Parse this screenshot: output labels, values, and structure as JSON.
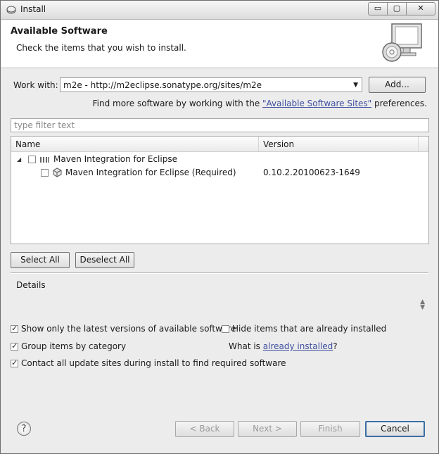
{
  "window": {
    "title": "Install",
    "controls": {
      "minimize": "▭",
      "maximize": "▢",
      "close": "✕"
    }
  },
  "banner": {
    "title": "Available Software",
    "description": "Check the items that you wish to install."
  },
  "work_with": {
    "label": "Work with:",
    "value": "m2e - http://m2eclipse.sonatype.org/sites/m2e",
    "add_button": "Add..."
  },
  "find_more": {
    "prefix": "Find more software by working with the ",
    "link": "\"Available Software Sites\"",
    "suffix": " preferences."
  },
  "filter": {
    "placeholder": "type filter text",
    "value": ""
  },
  "tree": {
    "columns": {
      "name": "Name",
      "version": "Version"
    },
    "rows": [
      {
        "expander": "◢",
        "checked": false,
        "icon": "category-icon",
        "name": "Maven Integration for Eclipse",
        "version": ""
      },
      {
        "checked": false,
        "icon": "feature-plugin-icon",
        "name": "Maven Integration for Eclipse (Required)",
        "version": "0.10.2.20100623-1649"
      }
    ]
  },
  "buttons": {
    "select_all": "Select All",
    "deselect_all": "Deselect All",
    "back": "< Back",
    "next": "Next >",
    "finish": "Finish",
    "cancel": "Cancel"
  },
  "details": {
    "label": "Details"
  },
  "options": {
    "show_latest": {
      "label": "Show only the latest versions of available software",
      "checked": true
    },
    "hide_installed": {
      "label": "Hide items that are already installed",
      "checked": false
    },
    "group_by_category": {
      "label": "Group items by category",
      "checked": true
    },
    "what_is_prefix": "What is ",
    "what_is_link": "already installed",
    "what_is_suffix": "?",
    "contact_sites": {
      "label": "Contact all update sites during install to find required software",
      "checked": true
    }
  },
  "help": {
    "symbol": "?"
  },
  "colors": {
    "link": "#3f4fa0",
    "default_button_border": "#3b6ea5"
  }
}
